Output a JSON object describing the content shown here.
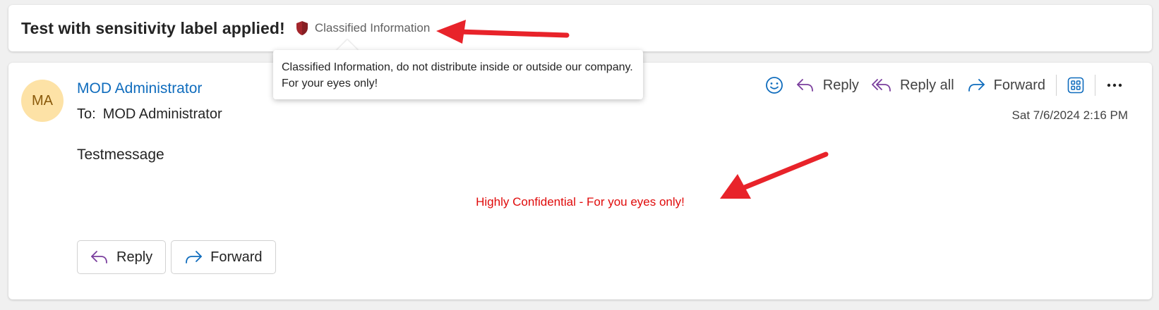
{
  "subject": "Test with sensitivity label applied!",
  "sensitivity_label": {
    "name": "Classified Information",
    "icon": "shield-icon",
    "color": "#a4262c",
    "tooltip": "Classified Information, do not distribute inside or outside our company. For your eyes only!"
  },
  "message": {
    "avatar_initials": "MA",
    "sender": "MOD Administrator",
    "to_label": "To:",
    "to": "MOD Administrator",
    "date": "Sat 7/6/2024 2:16 PM",
    "body": "Testmessage",
    "footer": "Highly Confidential - For you eyes only!"
  },
  "toolbar": {
    "reply_label": "Reply",
    "reply_all_label": "Reply all",
    "forward_label": "Forward"
  },
  "bottom_actions": {
    "reply_label": "Reply",
    "forward_label": "Forward"
  },
  "colors": {
    "accent": "#0f6cbd",
    "reply_purple": "#7a3e9d",
    "footer_red": "#e00b0b",
    "annotation_red": "#e8232a",
    "avatar_bg": "#fde2a6"
  }
}
